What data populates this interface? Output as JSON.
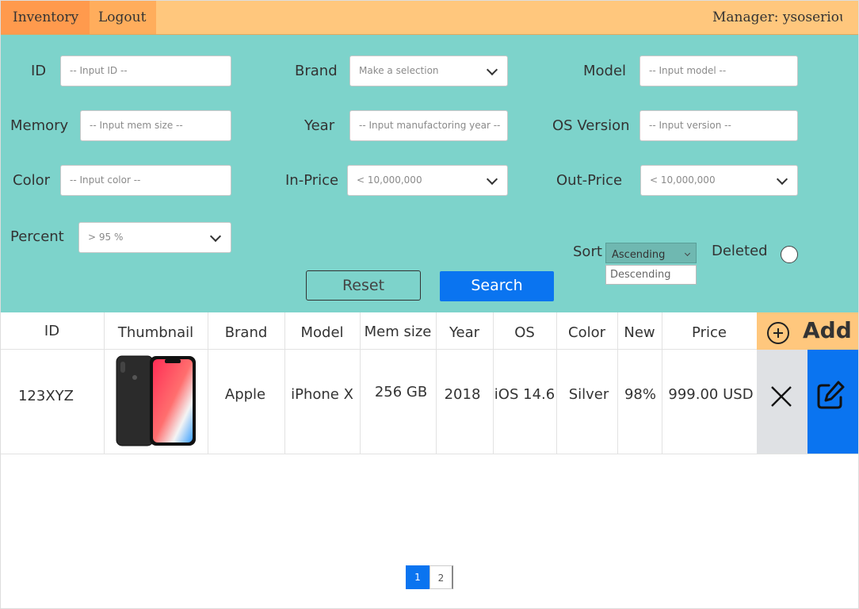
{
  "nav": {
    "inventory": "Inventory",
    "logout": "Logout",
    "manager": "Manager: ysoserious"
  },
  "filters": {
    "id": {
      "label": "ID",
      "placeholder": "-- Input ID --"
    },
    "brand": {
      "label": "Brand",
      "value": "Make a selection"
    },
    "model": {
      "label": "Model",
      "placeholder": "-- Input model --"
    },
    "memory": {
      "label": "Memory",
      "placeholder": "-- Input mem size --"
    },
    "year": {
      "label": "Year",
      "placeholder": "-- Input manufactoring year --"
    },
    "os_version": {
      "label": "OS Version",
      "placeholder": "-- Input version --"
    },
    "color": {
      "label": "Color",
      "placeholder": "-- Input color --"
    },
    "in_price": {
      "label": "In-Price",
      "value": "< 10,000,000"
    },
    "out_price": {
      "label": "Out-Price",
      "value": "< 10,000,000"
    },
    "percent": {
      "label": "Percent",
      "value": "> 95 %"
    },
    "sort": {
      "label": "Sort",
      "value": "Ascending",
      "options": [
        "Descending"
      ]
    },
    "deleted": {
      "label": "Deleted",
      "checked": false
    },
    "reset": "Reset",
    "search": "Search"
  },
  "table": {
    "headers": [
      "ID",
      "Thumbnail",
      "Brand",
      "Model",
      "Mem size",
      "Year",
      "OS",
      "Color",
      "New",
      "Price"
    ],
    "add_label": "Add",
    "rows": [
      {
        "id": "123XYZ",
        "brand": "Apple",
        "model": "iPhone X",
        "mem": "256 GB",
        "year": "2018",
        "os": "iOS 14.6",
        "color": "Silver",
        "new": "98%",
        "price": "999.00 USD"
      }
    ]
  },
  "pagination": {
    "pages": [
      "1",
      "2"
    ],
    "current": "1"
  },
  "colors": {
    "nav": "#ffc77d",
    "panel": "#7dd3cb",
    "accent": "#0a74f0"
  }
}
